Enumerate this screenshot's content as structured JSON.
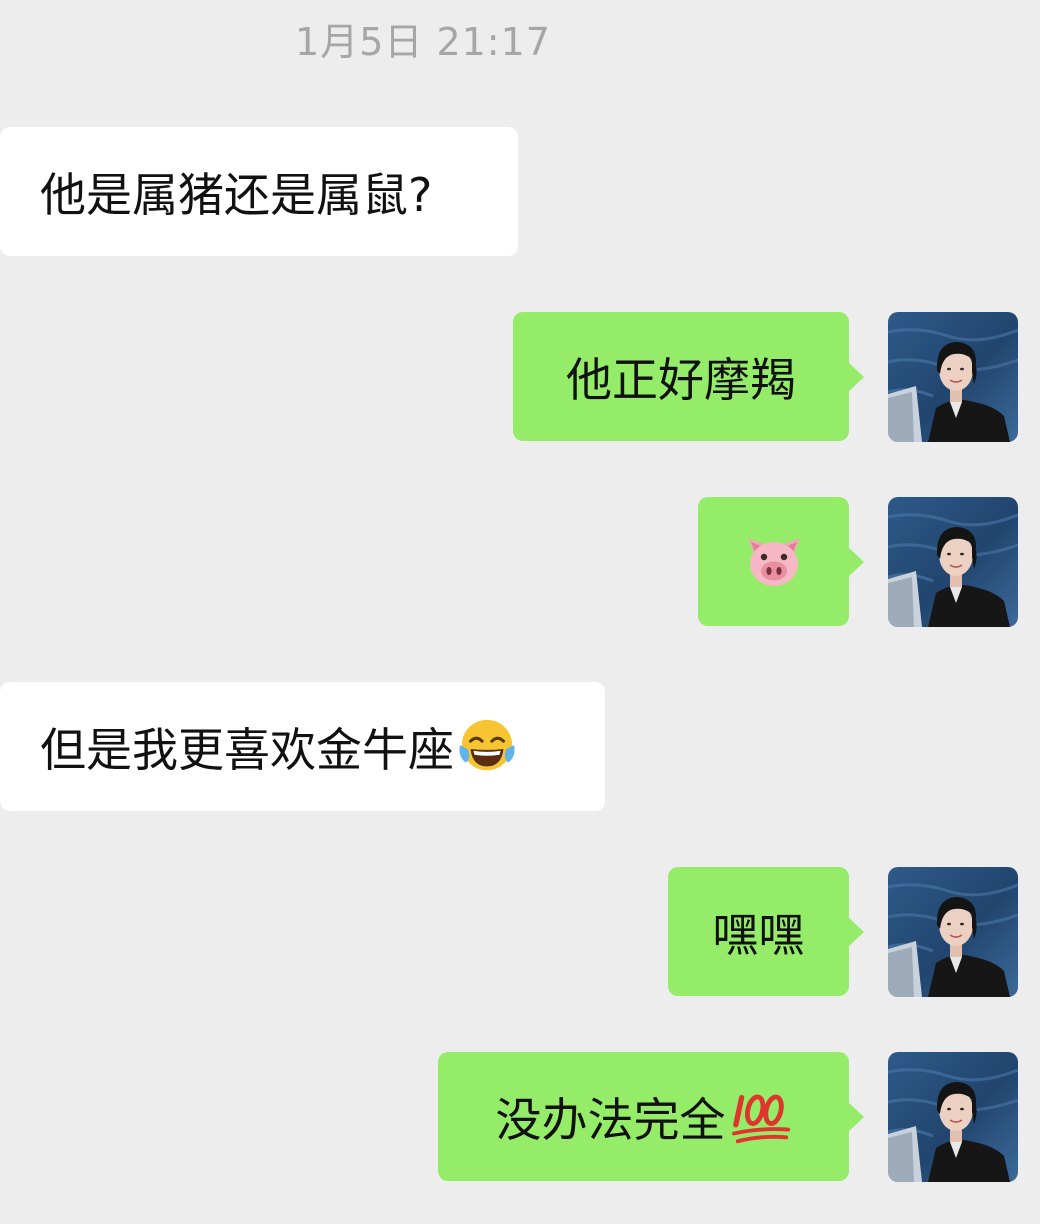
{
  "chat": {
    "timestamp": "1月5日 21:17",
    "messages": [
      {
        "from": "other",
        "text": "他是属猪还是属鼠?"
      },
      {
        "from": "self",
        "text": "他正好摩羯"
      },
      {
        "from": "self",
        "emoji": "pig-face"
      },
      {
        "from": "other",
        "text": "但是我更喜欢金牛座",
        "emoji": "face-with-tears-of-joy"
      },
      {
        "from": "self",
        "text": "嘿嘿"
      },
      {
        "from": "self",
        "text": "没办法完全",
        "emoji": "hundred-points"
      }
    ]
  },
  "colors": {
    "background": "#ededed",
    "incoming_bubble": "#ffffff",
    "outgoing_bubble": "#95ec69",
    "timestamp_text": "#a6a6a6",
    "message_text": "#111111"
  }
}
